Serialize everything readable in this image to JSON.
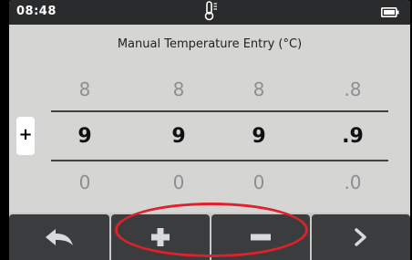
{
  "status": {
    "time": "08:48",
    "center_icon": "thermometer-icon",
    "right_icon": "battery-icon"
  },
  "title": "Manual Temperature Entry (°C)",
  "sign": "+",
  "digits": {
    "above": [
      "8",
      "8",
      "8",
      ".8"
    ],
    "selected": [
      "9",
      "9",
      "9",
      ".9"
    ],
    "below": [
      "0",
      "0",
      "0",
      ".0"
    ]
  },
  "softkeys": [
    {
      "name": "back",
      "icon": "back-arrow-icon"
    },
    {
      "name": "increment",
      "icon": "plus-icon"
    },
    {
      "name": "decrement",
      "icon": "minus-icon"
    },
    {
      "name": "next",
      "icon": "chevron-right-icon"
    }
  ],
  "colors": {
    "screen_bg": "#d5d6d4",
    "status_bar": "#2a2b2d",
    "softkey": "#3a3c3e",
    "highlight_ring": "#e0202a"
  }
}
